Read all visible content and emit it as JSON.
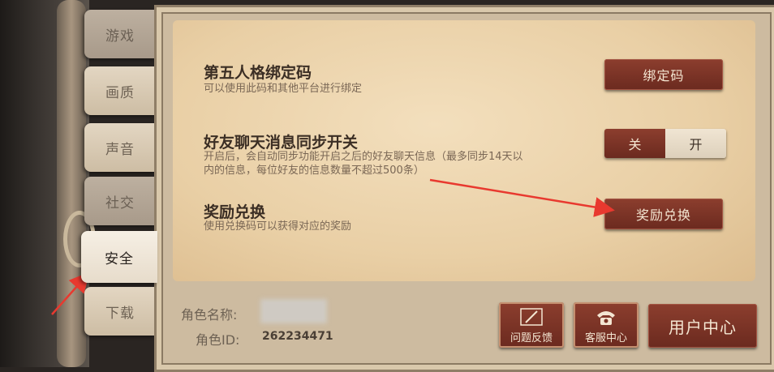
{
  "sidebar": {
    "tabs": [
      {
        "label": "游戏"
      },
      {
        "label": "画质"
      },
      {
        "label": "声音"
      },
      {
        "label": "社交"
      },
      {
        "label": "安全",
        "active": true
      },
      {
        "label": "下载"
      }
    ]
  },
  "settings": {
    "bind_code": {
      "title": "第五人格绑定码",
      "desc": "可以使用此码和其他平台进行绑定",
      "button_label": "绑定码"
    },
    "chat_sync": {
      "title": "好友聊天消息同步开关",
      "desc_line1": "开启后，会自动同步功能开启之后的好友聊天信息（最多同步14天以",
      "desc_line2": "内的信息，每位好友的信息数量不超过500条）",
      "toggle_off": "关",
      "toggle_on": "开",
      "state": "off"
    },
    "reward_redeem": {
      "title": "奖励兑换",
      "desc": "使用兑换码可以获得对应的奖励",
      "button_label": "奖励兑换"
    }
  },
  "footer": {
    "role_name_label": "角色名称:",
    "role_id_label": "角色ID:",
    "role_id_value": "262234471",
    "feedback_label": "问题反馈",
    "support_label": "客服中心",
    "user_center_label": "用户中心"
  },
  "colors": {
    "accent_button": "#7a3325",
    "annotation_arrow": "#e8392f",
    "panel_paper": "#ecd3a9"
  },
  "icons": [
    "pencil-icon",
    "telephone-icon"
  ]
}
